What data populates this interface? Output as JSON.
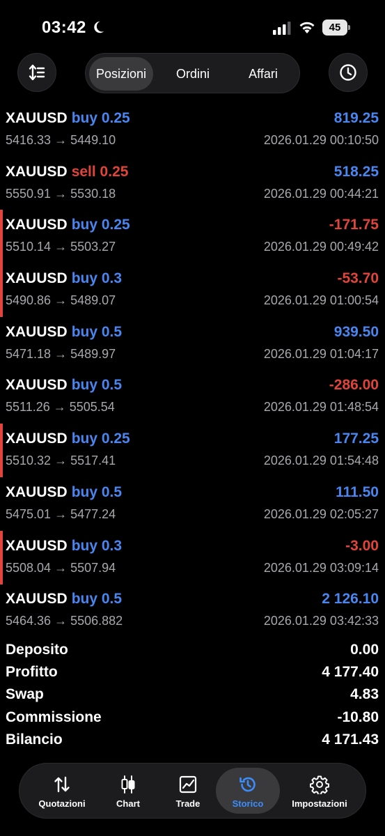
{
  "status_bar": {
    "time": "03:42",
    "battery": "45"
  },
  "top_nav": {
    "tabs": [
      {
        "label": "Posizioni",
        "active": true
      },
      {
        "label": "Ordini",
        "active": false
      },
      {
        "label": "Affari",
        "active": false
      }
    ],
    "left_icon": "sort-icon",
    "right_icon": "clock-icon"
  },
  "colors": {
    "buy": "#4a86f0",
    "sell": "#e0443a",
    "profit_pos": "#4a86f0",
    "profit_neg": "#e0443a",
    "accent": "#3c8dfb"
  },
  "trades": [
    {
      "symbol": "XAUUSD",
      "direction": "buy 0.25",
      "prices": "5416.33 → 5449.10",
      "profit": "819.25",
      "time": "2026.01.29 00:10:50",
      "negative": false,
      "marked": false
    },
    {
      "symbol": "XAUUSD",
      "direction": "sell 0.25",
      "prices": "5550.91 → 5530.18",
      "profit": "518.25",
      "time": "2026.01.29 00:44:21",
      "negative": false,
      "marked": false
    },
    {
      "symbol": "XAUUSD",
      "direction": "buy 0.25",
      "prices": "5510.14 → 5503.27",
      "profit": "-171.75",
      "time": "2026.01.29 00:49:42",
      "negative": true,
      "marked": true
    },
    {
      "symbol": "XAUUSD",
      "direction": "buy 0.3",
      "prices": "5490.86 → 5489.07",
      "profit": "-53.70",
      "time": "2026.01.29 01:00:54",
      "negative": true,
      "marked": true
    },
    {
      "symbol": "XAUUSD",
      "direction": "buy 0.5",
      "prices": "5471.18 → 5489.97",
      "profit": "939.50",
      "time": "2026.01.29 01:04:17",
      "negative": false,
      "marked": false
    },
    {
      "symbol": "XAUUSD",
      "direction": "buy 0.5",
      "prices": "5511.26 → 5505.54",
      "profit": "-286.00",
      "time": "2026.01.29 01:48:54",
      "negative": true,
      "marked": false
    },
    {
      "symbol": "XAUUSD",
      "direction": "buy 0.25",
      "prices": "5510.32 → 5517.41",
      "profit": "177.25",
      "time": "2026.01.29 01:54:48",
      "negative": false,
      "marked": true
    },
    {
      "symbol": "XAUUSD",
      "direction": "buy 0.5",
      "prices": "5475.01 → 5477.24",
      "profit": "111.50",
      "time": "2026.01.29 02:05:27",
      "negative": false,
      "marked": false
    },
    {
      "symbol": "XAUUSD",
      "direction": "buy 0.3",
      "prices": "5508.04 → 5507.94",
      "profit": "-3.00",
      "time": "2026.01.29 03:09:14",
      "negative": true,
      "marked": true
    },
    {
      "symbol": "XAUUSD",
      "direction": "buy 0.5",
      "prices": "5464.36 → 5506.882",
      "profit": "2 126.10",
      "time": "2026.01.29 03:42:33",
      "negative": false,
      "marked": false
    }
  ],
  "summary": [
    {
      "label": "Deposito",
      "value": "0.00"
    },
    {
      "label": "Profitto",
      "value": "4 177.40"
    },
    {
      "label": "Swap",
      "value": "4.83"
    },
    {
      "label": "Commissione",
      "value": "-10.80"
    },
    {
      "label": "Bilancio",
      "value": "4 171.43"
    }
  ],
  "tab_bar": [
    {
      "label": "Quotazioni",
      "icon": "quotes-arrows-icon",
      "active": false
    },
    {
      "label": "Chart",
      "icon": "candlestick-icon",
      "active": false
    },
    {
      "label": "Trade",
      "icon": "trade-chart-icon",
      "active": false
    },
    {
      "label": "Storico",
      "icon": "history-icon",
      "active": true
    },
    {
      "label": "Impostazioni",
      "icon": "gear-icon",
      "active": false
    }
  ]
}
